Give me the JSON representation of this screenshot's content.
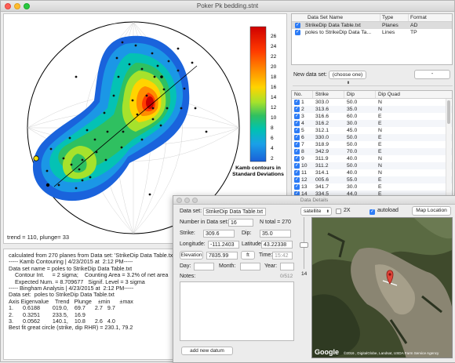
{
  "window": {
    "title": "Poker Pk bedding.stnt"
  },
  "plot": {
    "colorbar_ticks": [
      "26",
      "24",
      "22",
      "20",
      "18",
      "16",
      "14",
      "12",
      "10",
      "8",
      "6",
      "4",
      "2"
    ],
    "colorbar_label_line1": "Kamb contours in",
    "colorbar_label_line2": "Standard Deviations",
    "trend_plunge": "trend = 110, plunge= 33"
  },
  "datasets": {
    "headers": [
      "Data Set Name",
      "Type",
      "Format"
    ],
    "rows": [
      {
        "name": "StrikeDip Data Table.txt",
        "type": "Planes",
        "format": "AD"
      },
      {
        "name": "poles to StrikeDip Data Ta...",
        "type": "Lines",
        "format": "TP"
      }
    ],
    "new_label": "New data set:",
    "new_select": "(choose one)",
    "minus_button": "-"
  },
  "datatable": {
    "headers": [
      "No.",
      "Strike",
      "Dip",
      "Dip Quad"
    ],
    "rows": [
      [
        "1",
        "303.0",
        "50.0",
        "N"
      ],
      [
        "2",
        "313.6",
        "35.0",
        "N"
      ],
      [
        "3",
        "316.6",
        "60.0",
        "E"
      ],
      [
        "4",
        "316.2",
        "30.0",
        "E"
      ],
      [
        "5",
        "312.1",
        "45.0",
        "N"
      ],
      [
        "6",
        "330.0",
        "50.0",
        "E"
      ],
      [
        "7",
        "318.9",
        "50.0",
        "E"
      ],
      [
        "8",
        "342.9",
        "70.0",
        "E"
      ],
      [
        "9",
        "311.9",
        "40.0",
        "N"
      ],
      [
        "10",
        "311.2",
        "50.0",
        "N"
      ],
      [
        "11",
        "314.1",
        "40.0",
        "N"
      ],
      [
        "12",
        "005.6",
        "55.0",
        "E"
      ],
      [
        "13",
        "341.7",
        "30.0",
        "E"
      ],
      [
        "14",
        "334.5",
        "44.0",
        "E"
      ],
      [
        "15",
        "319.5",
        "53.0",
        "E"
      ]
    ]
  },
  "output_lines": [
    "calculated from 270 planes from Data set: 'StrikeDip Data Table.txt'",
    "",
    "----- Kamb Contouring | 4/23/2015 at  2:12 PM-----",
    "Data set name = poles to StrikeDip Data Table.txt",
    "    Contour Int.     = 2 sigma;    Counting Area = 3.2% of net area",
    "    Expected Num. = 8.709677   Signif. Level = 3 sigma",
    "",
    "----- Bingham Analysis | 4/23/2015 at  2:12 PM-----",
    "Data set:  poles to StrikeDip Data Table.txt",
    "Axis Eigenvalue    Trend   Plunge    ±min      ±max",
    "1.      0.6188        019.0,    69.7      2.7   9.7",
    "2.      0.3251        233.5,    16.9",
    "3.      0.0562        140.1,    10.8      2.6   4.0",
    "Best fit great circle (strike, dip RHR) = 230.1, 79.2"
  ],
  "details": {
    "title": "Data Details",
    "dataset_label": "Data set:",
    "dataset_value": "StrikeDip Data Table.txt",
    "ntotal": "N total = 270",
    "number_label": "Number in Data set:",
    "number_value": "16",
    "strike_label": "Strike:",
    "strike_value": "309.6",
    "dip_label": "Dip:",
    "dip_value": "35.0",
    "longitude_label": "Longitude:",
    "longitude_value": "-111.2403",
    "latitude_label": "Latitude:",
    "latitude_value": "43.22338",
    "elevation_button": "Elevation",
    "elevation_value": "7835.99",
    "elevation_unit": "ft",
    "time_label": "Time:",
    "time_value": "15:42",
    "day_label": "Day:",
    "month_label": "Month:",
    "year_label": "Year:",
    "notes_label": "Notes:",
    "notes_count": "0/512",
    "map_type": "satellite",
    "zoom_2x": "2X",
    "autoload": "autoload",
    "map_location": "Map Location",
    "zoom_level": "14",
    "add_datum": "add new datum",
    "google": "Google",
    "attribution": "©2016 , DigitalGlobe, Landsat, USDA Farm Service Agency"
  }
}
